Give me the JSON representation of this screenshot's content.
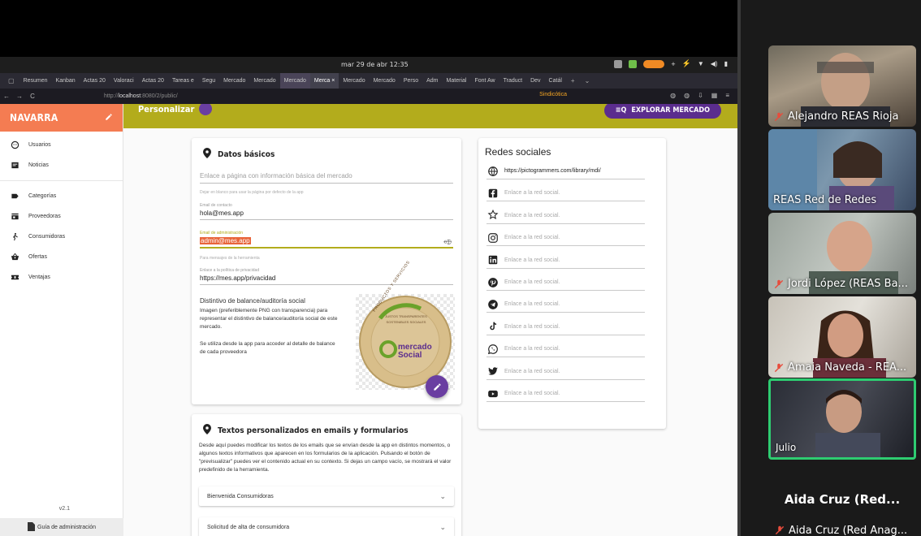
{
  "system": {
    "clock": "mar 29 de abr  12:35",
    "tabs": [
      "Resumen",
      "Kanban",
      "Actas 20",
      "Valoraci",
      "Actas 20",
      "Tareas e",
      "Segu",
      "Mercado",
      "Mercado",
      "Mercado",
      "Merca ×",
      "Mercado",
      "Mercado",
      "Perso",
      "Adm",
      "Material",
      "Font Aw",
      "Traduct",
      "Dev",
      "Catál"
    ],
    "url_prefix": "http://",
    "url_host": "localhost",
    "url_rest": ":8080/2/public/",
    "sync_label": "Sindicótica"
  },
  "app": {
    "brand": "NAVARRA",
    "nav_group1": [
      {
        "label": "Usuarios",
        "icon": "face-icon"
      },
      {
        "label": "Noticias",
        "icon": "news-icon"
      }
    ],
    "nav_group2": [
      {
        "label": "Categorías",
        "icon": "label-icon"
      },
      {
        "label": "Proveedoras",
        "icon": "store-icon"
      },
      {
        "label": "Consumidoras",
        "icon": "person-walk-icon"
      },
      {
        "label": "Ofertas",
        "icon": "basket-icon"
      },
      {
        "label": "Ventajas",
        "icon": "ticket-icon"
      }
    ],
    "version": "v2.1",
    "guide": "Guía de administración",
    "header_title": "Personalizar",
    "explore_button": "EXPLORAR MERCADO"
  },
  "basic": {
    "title": "Datos básicos",
    "info_link_placeholder": "Enlace a página con información básica del mercado",
    "info_link_help": "Dejar en blanco para usar la página por defecto de la app",
    "contact_label": "Email de contacto",
    "contact_value": "hola@mes.app",
    "admin_label": "Email de administración",
    "admin_value": "admin@mes.app",
    "admin_help": "Para mensajes de la herramienta",
    "privacy_label": "Enlace a la política de privacidad",
    "privacy_value": "https://mes.app/privacidad",
    "badge_title": "Distintivo de balance/auditoría social",
    "badge_desc": "Imagen (preferiblemente PNG con transparencia) para representar el distintivo de balance/auditoría social de este mercado.",
    "badge_note": "Se utiliza desde la app para acceder al detalle de balance de cada proveedora",
    "badge_logo_text": "mercado",
    "badge_logo_text2": "Social",
    "badge_ring_text": "PRODUCTOS Y SERVICIOS",
    "badge_inner_text": "JUSTOS TRANSPARENTES SOSTENIBLES SOCIALES"
  },
  "social": {
    "title": "Redes sociales",
    "links": [
      {
        "icon": "web-icon",
        "text": "https://pictogrammers.com/library/mdi/",
        "filled": true
      },
      {
        "icon": "facebook-icon",
        "text": "Enlace a la red social.",
        "filled": false
      },
      {
        "icon": "mastodon-icon",
        "text": "Enlace a la red social.",
        "filled": false
      },
      {
        "icon": "instagram-icon",
        "text": "Enlace a la red social.",
        "filled": false
      },
      {
        "icon": "linkedin-icon",
        "text": "Enlace a la red social.",
        "filled": false
      },
      {
        "icon": "pinterest-icon",
        "text": "Enlace a la red social.",
        "filled": false
      },
      {
        "icon": "telegram-icon",
        "text": "Enlace a la red social.",
        "filled": false
      },
      {
        "icon": "tiktok-icon",
        "text": "Enlace a la red social.",
        "filled": false
      },
      {
        "icon": "whatsapp-icon",
        "text": "Enlace a la red social.",
        "filled": false
      },
      {
        "icon": "twitter-icon",
        "text": "Enlace a la red social.",
        "filled": false
      },
      {
        "icon": "youtube-icon",
        "text": "Enlace a la red social.",
        "filled": false
      }
    ]
  },
  "texts": {
    "title": "Textos personalizados en emails y formularios",
    "description": "Desde aquí puedes modificar los textos de los emails que se envían desde la app en distintos momentos, o algunos textos informativos que aparecen en los formularios de la aplicación. Pulsando el botón de \"previsualizar\" puedes ver el contenido actual en su contexto. Si dejas un campo vacío, se mostrará el valor predefinido de la herramienta.",
    "accordion": [
      "Bienvenida Consumidoras",
      "Solicitud de alta de consumidora"
    ]
  },
  "participants": [
    {
      "name": "Alejandro REAS Rioja",
      "muted": true
    },
    {
      "name": "REAS Red de Redes",
      "muted": false
    },
    {
      "name": "Jordi López (REAS Ba...",
      "muted": true
    },
    {
      "name": "Amaia Naveda - REA...",
      "muted": true
    },
    {
      "name": "Julio",
      "muted": false,
      "speaking": true
    }
  ],
  "aida": {
    "name": "Aida Cruz (Red...",
    "bottom": "Aida Cruz (Red Anag..."
  },
  "colors": {
    "brand": "#f47c52",
    "band": "#b3ac1c",
    "accent": "#6a3ea1",
    "speaking": "#2ecc71"
  }
}
